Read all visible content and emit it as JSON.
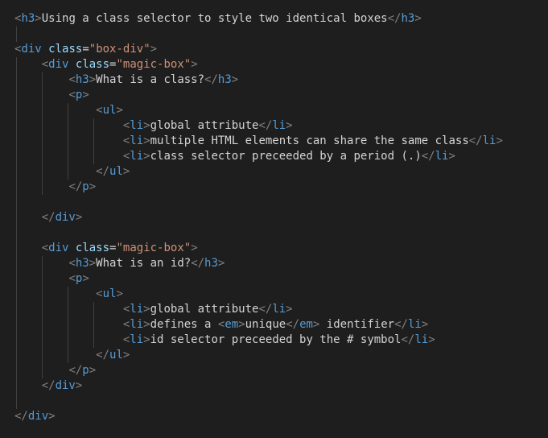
{
  "lines": [
    {
      "indent": 0,
      "blank": false,
      "segs": [
        {
          "c": "p",
          "t": "<"
        },
        {
          "c": "tg",
          "t": "h3"
        },
        {
          "c": "p",
          "t": ">"
        },
        {
          "c": "tx",
          "t": "Using a class selector to style two identical boxes"
        },
        {
          "c": "p",
          "t": "</"
        },
        {
          "c": "tg",
          "t": "h3"
        },
        {
          "c": "p",
          "t": ">"
        }
      ]
    },
    {
      "indent": 0,
      "blank": true,
      "segs": []
    },
    {
      "indent": 0,
      "blank": false,
      "segs": [
        {
          "c": "p",
          "t": "<"
        },
        {
          "c": "tg",
          "t": "div"
        },
        {
          "c": "tx",
          "t": " "
        },
        {
          "c": "an",
          "t": "class"
        },
        {
          "c": "eq",
          "t": "="
        },
        {
          "c": "av",
          "t": "\"box-div\""
        },
        {
          "c": "p",
          "t": ">"
        }
      ]
    },
    {
      "indent": 1,
      "blank": false,
      "segs": [
        {
          "c": "p",
          "t": "<"
        },
        {
          "c": "tg",
          "t": "div"
        },
        {
          "c": "tx",
          "t": " "
        },
        {
          "c": "an",
          "t": "class"
        },
        {
          "c": "eq",
          "t": "="
        },
        {
          "c": "av",
          "t": "\"magic-box\""
        },
        {
          "c": "p",
          "t": ">"
        }
      ]
    },
    {
      "indent": 2,
      "blank": false,
      "segs": [
        {
          "c": "p",
          "t": "<"
        },
        {
          "c": "tg",
          "t": "h3"
        },
        {
          "c": "p",
          "t": ">"
        },
        {
          "c": "tx",
          "t": "What is a class?"
        },
        {
          "c": "p",
          "t": "</"
        },
        {
          "c": "tg",
          "t": "h3"
        },
        {
          "c": "p",
          "t": ">"
        }
      ]
    },
    {
      "indent": 2,
      "blank": false,
      "segs": [
        {
          "c": "p",
          "t": "<"
        },
        {
          "c": "tg",
          "t": "p"
        },
        {
          "c": "p",
          "t": ">"
        }
      ]
    },
    {
      "indent": 3,
      "blank": false,
      "segs": [
        {
          "c": "p",
          "t": "<"
        },
        {
          "c": "tg",
          "t": "ul"
        },
        {
          "c": "p",
          "t": ">"
        }
      ]
    },
    {
      "indent": 4,
      "blank": false,
      "segs": [
        {
          "c": "p",
          "t": "<"
        },
        {
          "c": "tg",
          "t": "li"
        },
        {
          "c": "p",
          "t": ">"
        },
        {
          "c": "tx",
          "t": "global attribute"
        },
        {
          "c": "p",
          "t": "</"
        },
        {
          "c": "tg",
          "t": "li"
        },
        {
          "c": "p",
          "t": ">"
        }
      ]
    },
    {
      "indent": 4,
      "blank": false,
      "segs": [
        {
          "c": "p",
          "t": "<"
        },
        {
          "c": "tg",
          "t": "li"
        },
        {
          "c": "p",
          "t": ">"
        },
        {
          "c": "tx",
          "t": "multiple HTML elements can share the same class"
        },
        {
          "c": "p",
          "t": "</"
        },
        {
          "c": "tg",
          "t": "li"
        },
        {
          "c": "p",
          "t": ">"
        }
      ]
    },
    {
      "indent": 4,
      "blank": false,
      "segs": [
        {
          "c": "p",
          "t": "<"
        },
        {
          "c": "tg",
          "t": "li"
        },
        {
          "c": "p",
          "t": ">"
        },
        {
          "c": "tx",
          "t": "class selector preceeded by a period (.)"
        },
        {
          "c": "p",
          "t": "</"
        },
        {
          "c": "tg",
          "t": "li"
        },
        {
          "c": "p",
          "t": ">"
        }
      ]
    },
    {
      "indent": 3,
      "blank": false,
      "segs": [
        {
          "c": "p",
          "t": "</"
        },
        {
          "c": "tg",
          "t": "ul"
        },
        {
          "c": "p",
          "t": ">"
        }
      ]
    },
    {
      "indent": 2,
      "blank": false,
      "segs": [
        {
          "c": "p",
          "t": "</"
        },
        {
          "c": "tg",
          "t": "p"
        },
        {
          "c": "p",
          "t": ">"
        }
      ]
    },
    {
      "indent": 0,
      "blank": true,
      "segs": []
    },
    {
      "indent": 1,
      "blank": false,
      "segs": [
        {
          "c": "p",
          "t": "</"
        },
        {
          "c": "tg",
          "t": "div"
        },
        {
          "c": "p",
          "t": ">"
        }
      ]
    },
    {
      "indent": 0,
      "blank": true,
      "segs": []
    },
    {
      "indent": 1,
      "blank": false,
      "segs": [
        {
          "c": "p",
          "t": "<"
        },
        {
          "c": "tg",
          "t": "div"
        },
        {
          "c": "tx",
          "t": " "
        },
        {
          "c": "an",
          "t": "class"
        },
        {
          "c": "eq",
          "t": "="
        },
        {
          "c": "av",
          "t": "\"magic-box\""
        },
        {
          "c": "p",
          "t": ">"
        }
      ]
    },
    {
      "indent": 2,
      "blank": false,
      "segs": [
        {
          "c": "p",
          "t": "<"
        },
        {
          "c": "tg",
          "t": "h3"
        },
        {
          "c": "p",
          "t": ">"
        },
        {
          "c": "tx",
          "t": "What is an id?"
        },
        {
          "c": "p",
          "t": "</"
        },
        {
          "c": "tg",
          "t": "h3"
        },
        {
          "c": "p",
          "t": ">"
        }
      ]
    },
    {
      "indent": 2,
      "blank": false,
      "segs": [
        {
          "c": "p",
          "t": "<"
        },
        {
          "c": "tg",
          "t": "p"
        },
        {
          "c": "p",
          "t": ">"
        }
      ]
    },
    {
      "indent": 3,
      "blank": false,
      "segs": [
        {
          "c": "p",
          "t": "<"
        },
        {
          "c": "tg",
          "t": "ul"
        },
        {
          "c": "p",
          "t": ">"
        }
      ]
    },
    {
      "indent": 4,
      "blank": false,
      "segs": [
        {
          "c": "p",
          "t": "<"
        },
        {
          "c": "tg",
          "t": "li"
        },
        {
          "c": "p",
          "t": ">"
        },
        {
          "c": "tx",
          "t": "global attribute"
        },
        {
          "c": "p",
          "t": "</"
        },
        {
          "c": "tg",
          "t": "li"
        },
        {
          "c": "p",
          "t": ">"
        }
      ]
    },
    {
      "indent": 4,
      "blank": false,
      "segs": [
        {
          "c": "p",
          "t": "<"
        },
        {
          "c": "tg",
          "t": "li"
        },
        {
          "c": "p",
          "t": ">"
        },
        {
          "c": "tx",
          "t": "defines a "
        },
        {
          "c": "p",
          "t": "<"
        },
        {
          "c": "tg",
          "t": "em"
        },
        {
          "c": "p",
          "t": ">"
        },
        {
          "c": "tx",
          "t": "unique"
        },
        {
          "c": "p",
          "t": "</"
        },
        {
          "c": "tg",
          "t": "em"
        },
        {
          "c": "p",
          "t": ">"
        },
        {
          "c": "tx",
          "t": " identifier"
        },
        {
          "c": "p",
          "t": "</"
        },
        {
          "c": "tg",
          "t": "li"
        },
        {
          "c": "p",
          "t": ">"
        }
      ]
    },
    {
      "indent": 4,
      "blank": false,
      "segs": [
        {
          "c": "p",
          "t": "<"
        },
        {
          "c": "tg",
          "t": "li"
        },
        {
          "c": "p",
          "t": ">"
        },
        {
          "c": "tx",
          "t": "id selector preceeded by the # symbol"
        },
        {
          "c": "p",
          "t": "</"
        },
        {
          "c": "tg",
          "t": "li"
        },
        {
          "c": "p",
          "t": ">"
        }
      ]
    },
    {
      "indent": 3,
      "blank": false,
      "segs": [
        {
          "c": "p",
          "t": "</"
        },
        {
          "c": "tg",
          "t": "ul"
        },
        {
          "c": "p",
          "t": ">"
        }
      ]
    },
    {
      "indent": 2,
      "blank": false,
      "segs": [
        {
          "c": "p",
          "t": "</"
        },
        {
          "c": "tg",
          "t": "p"
        },
        {
          "c": "p",
          "t": ">"
        }
      ]
    },
    {
      "indent": 1,
      "blank": false,
      "segs": [
        {
          "c": "p",
          "t": "</"
        },
        {
          "c": "tg",
          "t": "div"
        },
        {
          "c": "p",
          "t": ">"
        }
      ]
    },
    {
      "indent": 0,
      "blank": true,
      "segs": []
    },
    {
      "indent": 0,
      "blank": false,
      "segs": [
        {
          "c": "p",
          "t": "</"
        },
        {
          "c": "tg",
          "t": "div"
        },
        {
          "c": "p",
          "t": ">"
        }
      ]
    }
  ],
  "indentUnitPx": 32,
  "guideCount": 5
}
